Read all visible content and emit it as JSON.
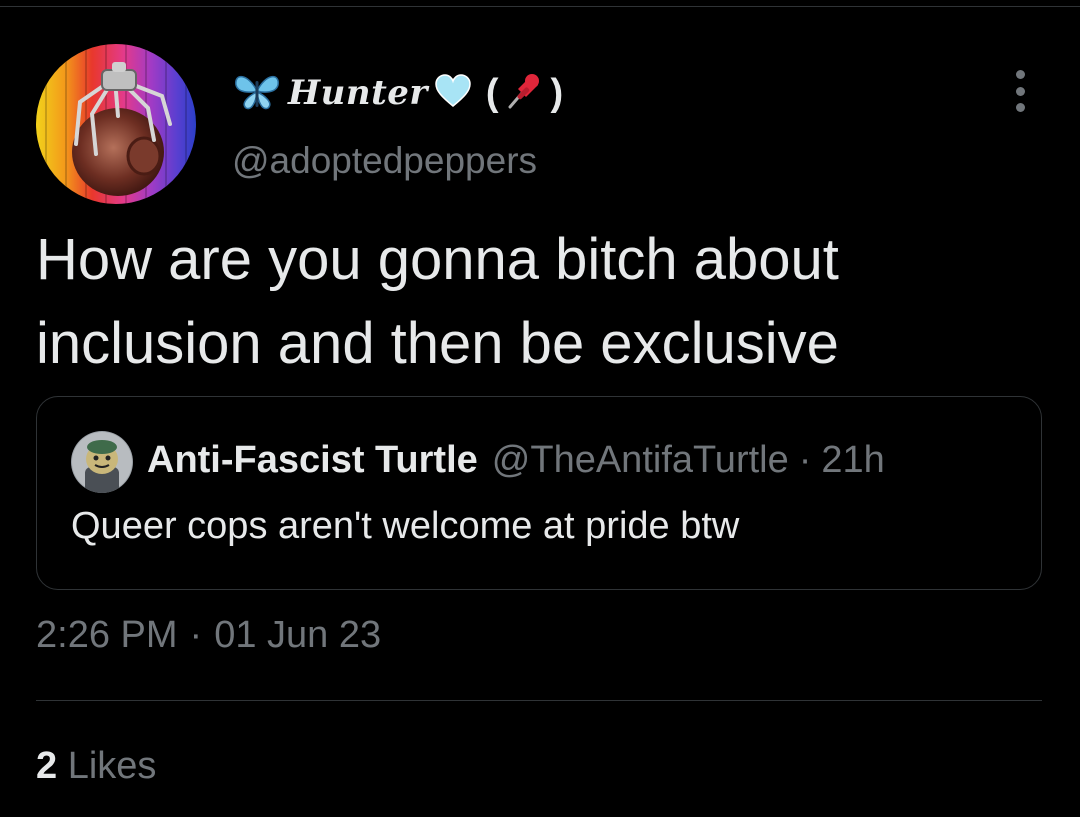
{
  "tweet": {
    "author": {
      "display_name": "Hunter",
      "name_prefix_icon": "butterfly-icon",
      "name_suffix_icon": "light-blue-heart-icon",
      "pin_icon": "pushpin-icon",
      "paren_open": "(",
      "paren_close": ")",
      "handle": "@adoptedpeppers"
    },
    "text_line1": "How are you gonna bitch about",
    "text_line2": "inclusion and then be exclusive",
    "quoted": {
      "name": "Anti-Fascist Turtle",
      "handle": "@TheAntifaTurtle",
      "separator": "·",
      "time": "21h",
      "text": "Queer cops aren't welcome at pride btw"
    },
    "time": "2:26 PM",
    "separator": "·",
    "date": "01 Jun 23",
    "likes_count": "2",
    "likes_label": "Likes"
  },
  "colors": {
    "background": "#000000",
    "text_primary": "#e7e9ea",
    "text_secondary": "#71767b",
    "border": "#2f3336",
    "heart": "#a8e4f5",
    "butterfly": "#6ec3ea",
    "pin": "#e0263a"
  }
}
